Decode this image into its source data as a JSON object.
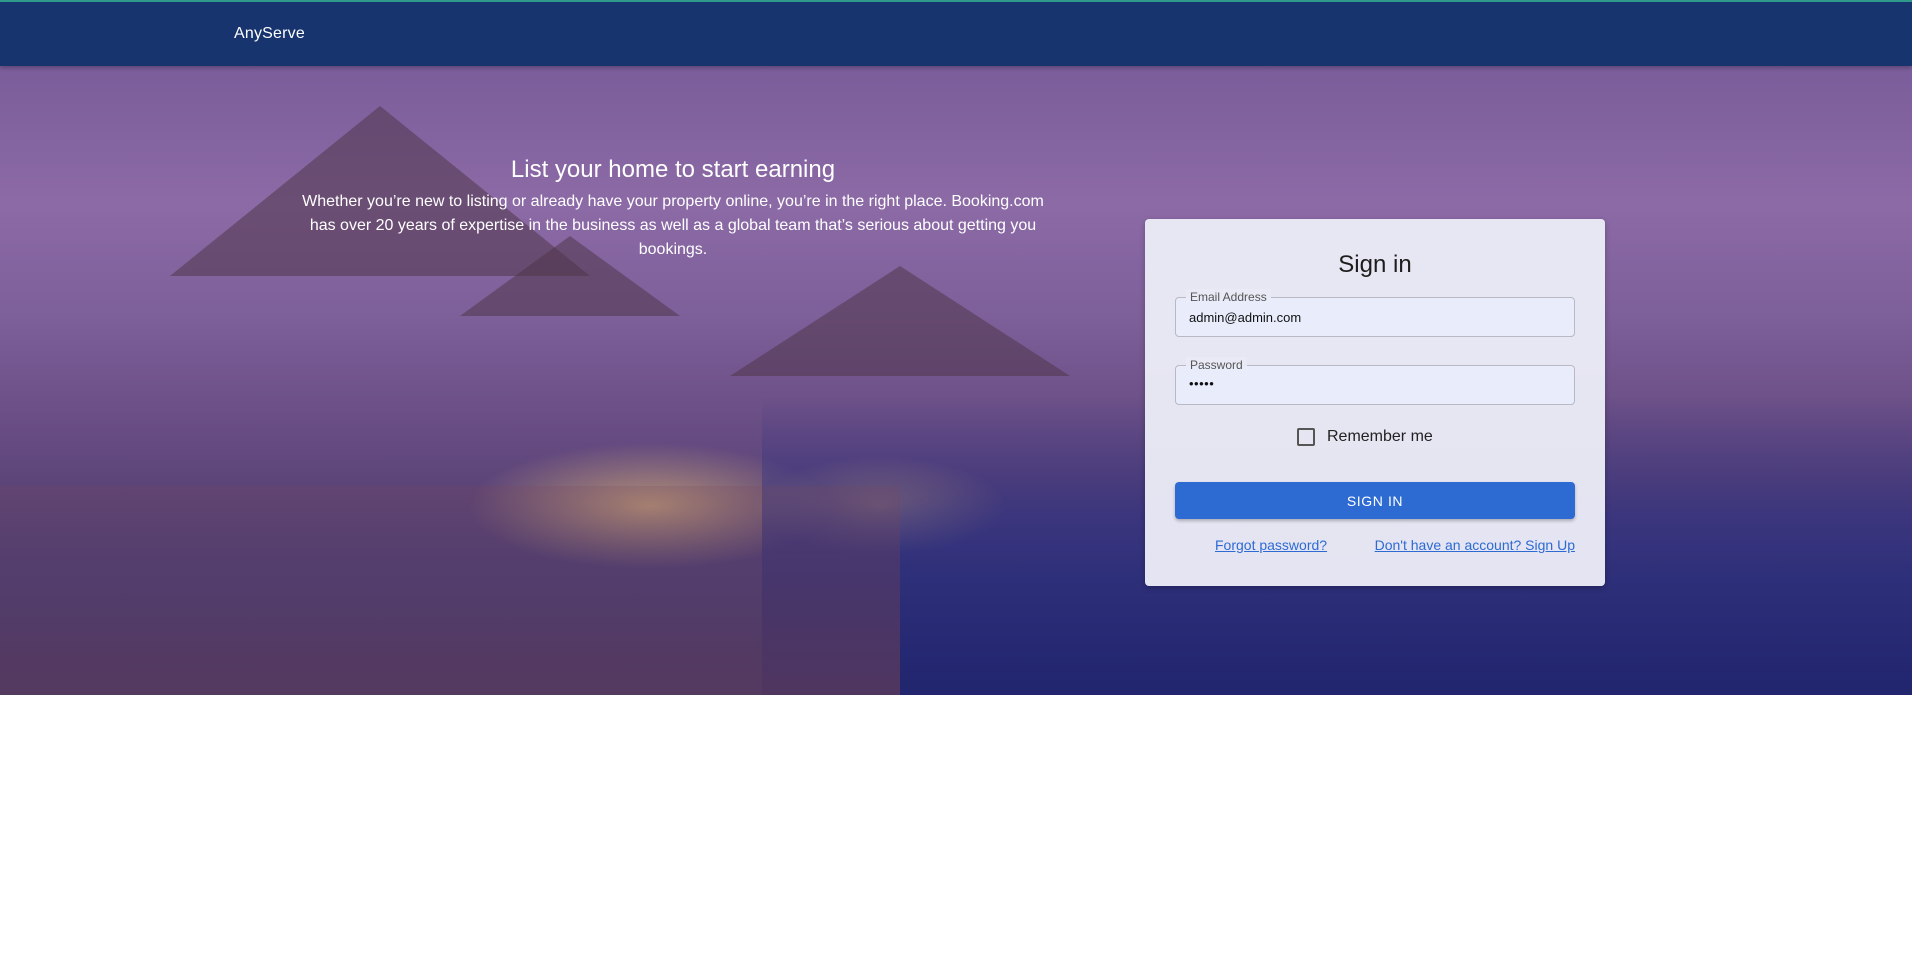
{
  "appbar": {
    "brand": "AnyServe"
  },
  "hero": {
    "title": "List your home to start earning",
    "body": "Whether you’re new to listing or already have your property online, you’re in the right place. Booking.com has over 20 years of expertise in the business as well as a global team that’s serious about getting you bookings."
  },
  "signin": {
    "title": "Sign in",
    "email": {
      "label": "Email Address",
      "value": "admin@admin.com"
    },
    "password": {
      "label": "Password",
      "value": "•••••"
    },
    "remember_label": "Remember me",
    "remember_checked": false,
    "submit_label": "SIGN IN",
    "forgot_link": "Forgot password?",
    "signup_link": "Don't have an account? Sign Up"
  },
  "colors": {
    "appbar": "#17346f",
    "primary": "#2d6bd3",
    "card": "#eaeaf6"
  }
}
